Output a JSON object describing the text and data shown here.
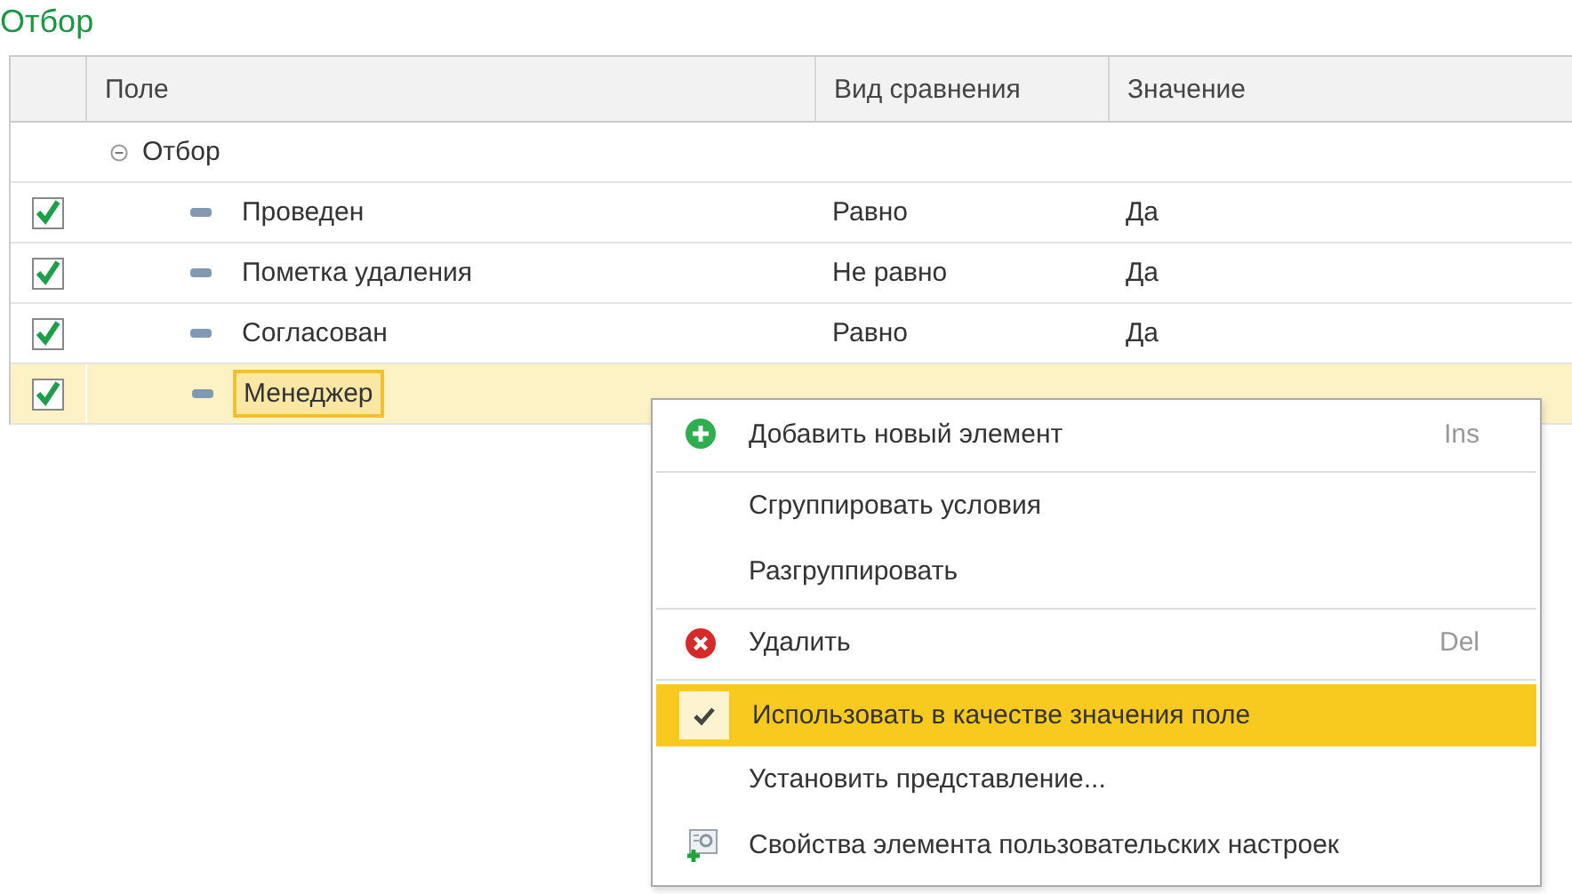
{
  "title": "Отбор",
  "table": {
    "columns": [
      "Поле",
      "Вид сравнения",
      "Значение"
    ],
    "tree": [
      {
        "field": "Отбор",
        "expanded": true,
        "children": [
          {
            "checked": true,
            "field": "Проведен",
            "comparison": "Равно",
            "value": "Да",
            "selected": false
          },
          {
            "checked": true,
            "field": "Пометка удаления",
            "comparison": "Не равно",
            "value": "Да",
            "selected": false
          },
          {
            "checked": true,
            "field": "Согласован",
            "comparison": "Равно",
            "value": "Да",
            "selected": false
          },
          {
            "checked": true,
            "field": "Менеджер",
            "selected": true
          }
        ]
      }
    ]
  },
  "context_menu": {
    "groups": [
      [
        {
          "kind": "add",
          "label": "Добавить новый элемент",
          "shortcut": "Ins",
          "checked": false,
          "selected": false
        }
      ],
      [
        {
          "label": "Сгруппировать условия",
          "checked": false,
          "selected": false
        },
        {
          "label": "Разгруппировать",
          "checked": false,
          "selected": false
        }
      ],
      [
        {
          "kind": "delete",
          "label": "Удалить",
          "shortcut": "Del",
          "checked": false,
          "selected": false
        }
      ],
      [
        {
          "label": "Использовать в качестве значения поле",
          "checked": true,
          "selected": true
        },
        {
          "label": "Установить представление...",
          "checked": false,
          "selected": false
        },
        {
          "kind": "settings",
          "label": "Свойства элемента пользовательских настроек",
          "checked": false,
          "selected": false
        }
      ]
    ]
  }
}
